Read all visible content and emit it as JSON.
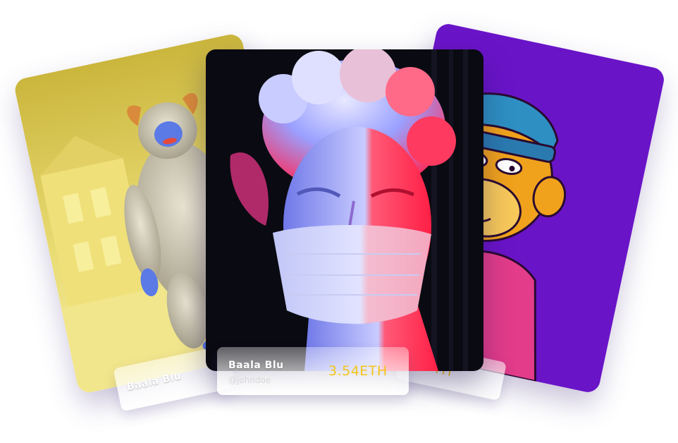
{
  "cards": {
    "left": {
      "name": "Baala Blu",
      "colors": {
        "background": "#ddc95a",
        "accent": "#f5ed8c"
      }
    },
    "center": {
      "name": "Baala Blu",
      "handle": "@johndoe",
      "price": "3.54ETH",
      "colors": {
        "background": "#0a0a12",
        "light_red": "#ff2a4a",
        "light_blue": "#8b96ff"
      }
    },
    "right": {
      "price_fragment": "TH",
      "colors": {
        "background": "#6a14c8",
        "accent": "#f5a21c"
      }
    }
  },
  "colors": {
    "price": "#f3c51a"
  }
}
